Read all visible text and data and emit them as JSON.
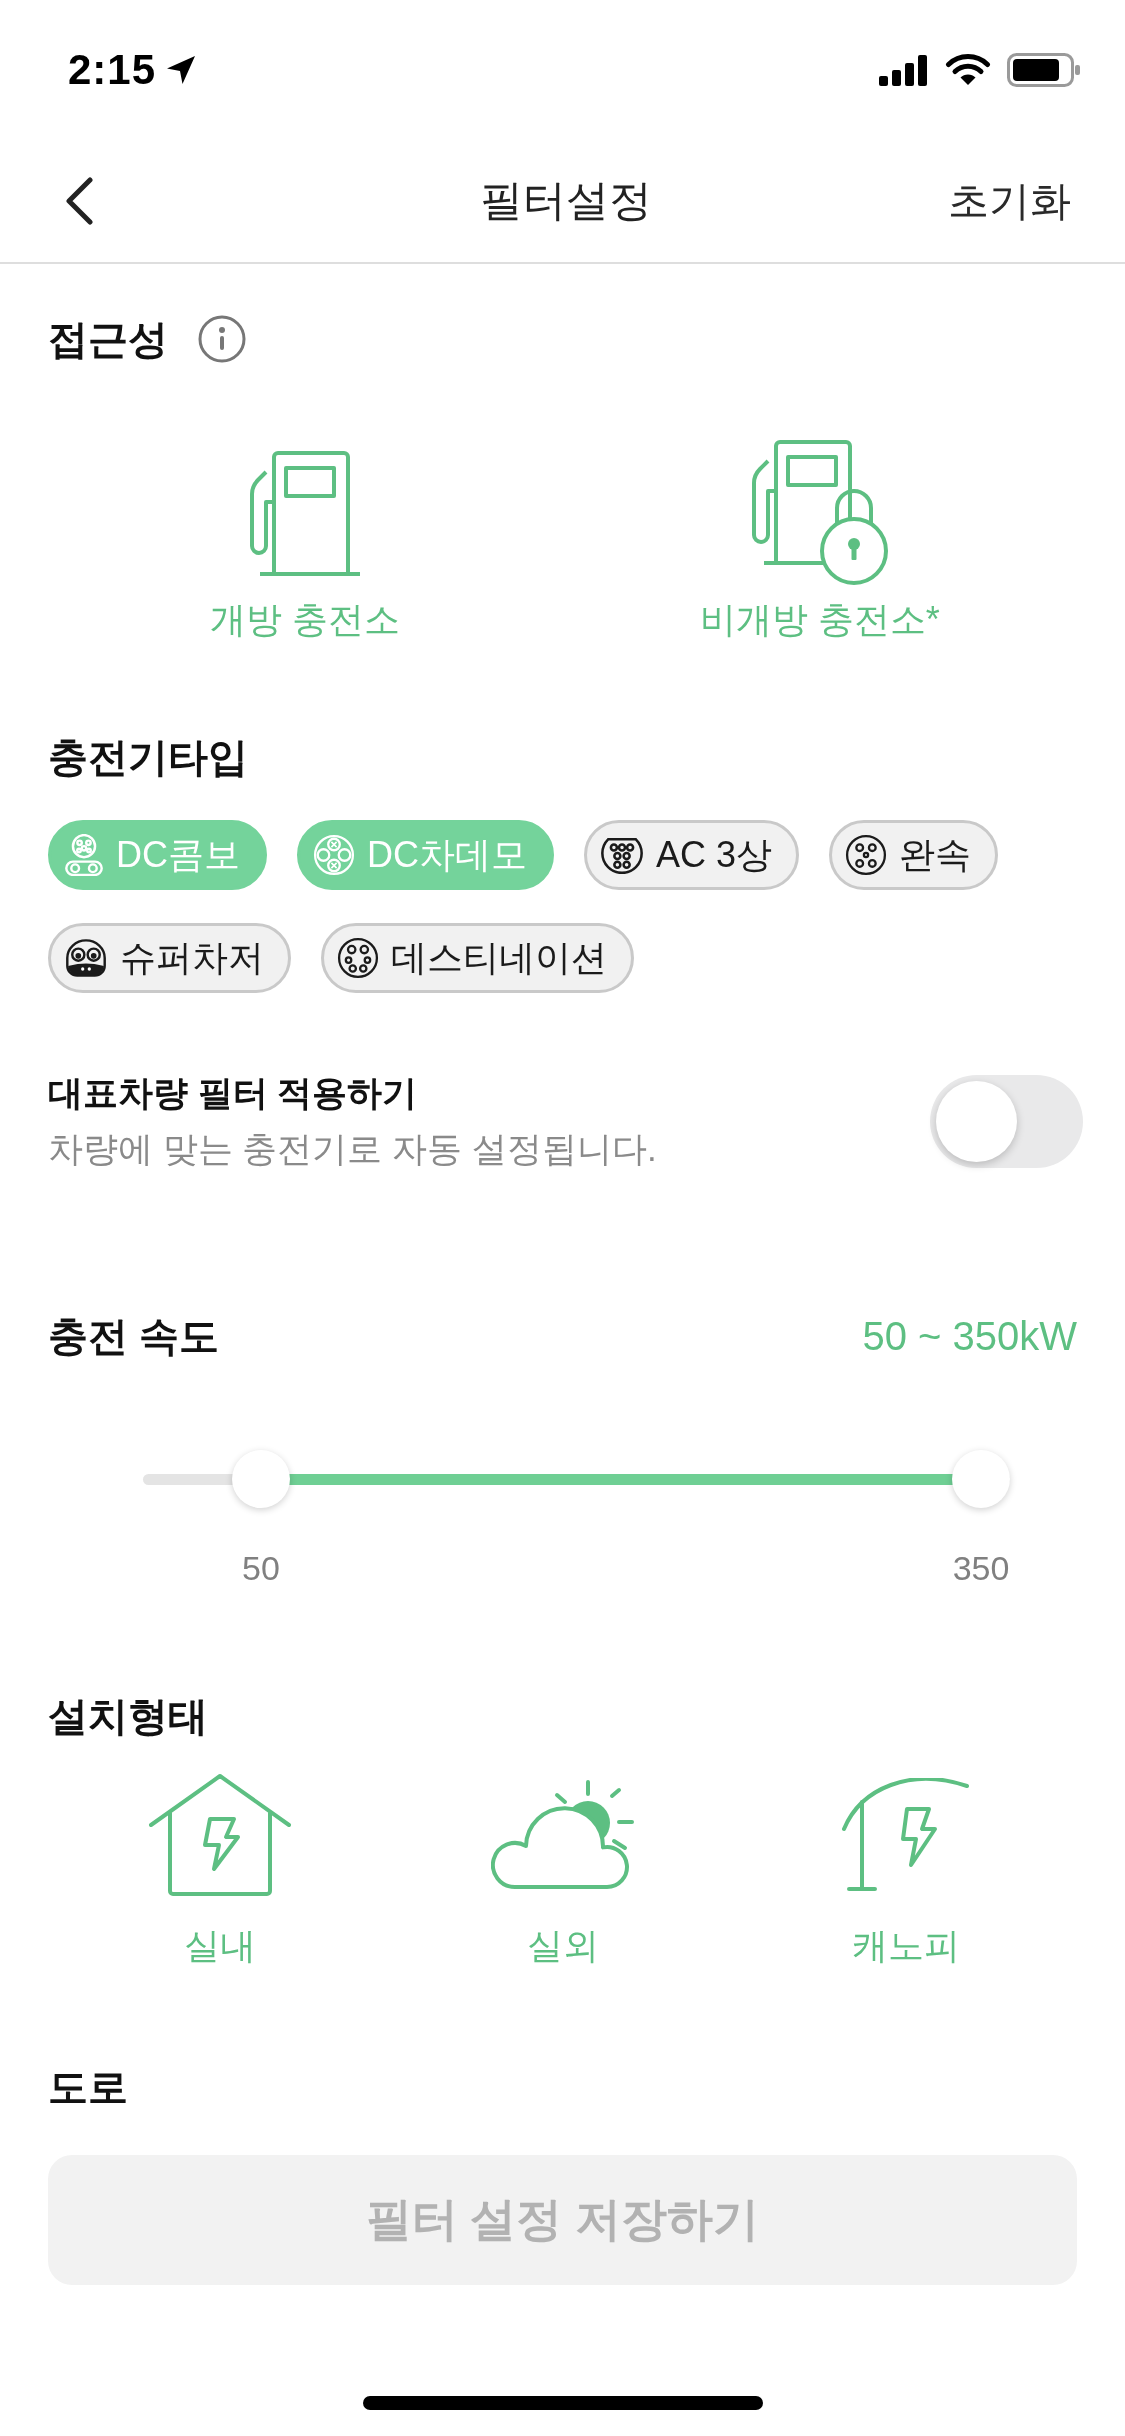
{
  "status_bar": {
    "time": "2:15"
  },
  "header": {
    "title": "필터설정",
    "reset": "초기화"
  },
  "accessibility": {
    "title": "접근성",
    "options": [
      {
        "kind": "open",
        "label": "개방 충전소",
        "selected": true
      },
      {
        "kind": "private",
        "label": "비개방 충전소*",
        "selected": true
      }
    ]
  },
  "charger_types": {
    "title": "충전기타입",
    "chips": [
      {
        "kind": "combo",
        "label": "DC콤보",
        "selected": true
      },
      {
        "kind": "chademo",
        "label": "DC차데모",
        "selected": true
      },
      {
        "kind": "type2",
        "label": "AC 3상",
        "selected": false
      },
      {
        "kind": "slow",
        "label": "완속",
        "selected": false
      },
      {
        "kind": "supercharger",
        "label": "슈퍼차저",
        "selected": false
      },
      {
        "kind": "destination",
        "label": "데스티네이션",
        "selected": false
      }
    ]
  },
  "vehicle_filter": {
    "title": "대표차량 필터 적용하기",
    "subtitle": "차량에 맞는 충전기로 자동 설정됩니다.",
    "on": false
  },
  "speed": {
    "title": "충전 속도",
    "range": "50 ~ 350kW",
    "thumbs": [
      {
        "level": 0.11,
        "label": "50"
      },
      {
        "level": 1,
        "label": "350"
      }
    ]
  },
  "install_type": {
    "title": "설치형태",
    "options": [
      {
        "kind": "indoor",
        "label": "실내",
        "selected": true
      },
      {
        "kind": "outdoor",
        "label": "실외",
        "selected": true
      },
      {
        "kind": "canopy",
        "label": "캐노피",
        "selected": true
      }
    ]
  },
  "road": {
    "title": "도로"
  },
  "save_button": {
    "label": "필터 설정 저장하기",
    "disabled": true
  }
}
